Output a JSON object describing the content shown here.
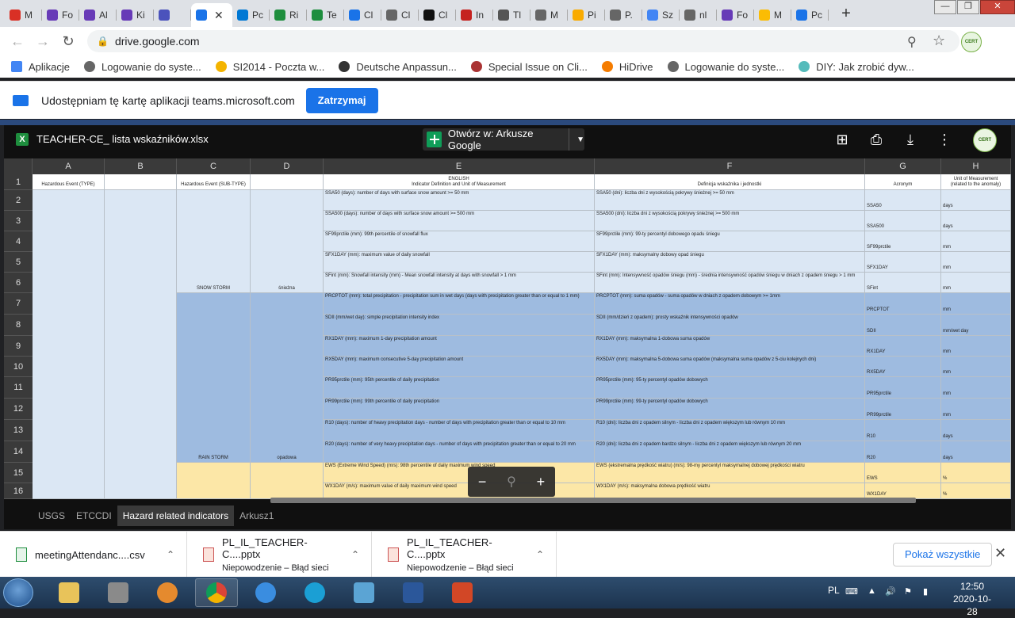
{
  "browser": {
    "tabs": [
      {
        "label": "M",
        "color": "#d93025"
      },
      {
        "label": "Fo",
        "color": "#673ab7"
      },
      {
        "label": "Al",
        "color": "#673ab7"
      },
      {
        "label": "Ki",
        "color": "#673ab7"
      },
      {
        "label": "",
        "color": "#4b53bc"
      },
      {
        "label": "",
        "color": "#1a73e8",
        "active": true
      },
      {
        "label": "Pc",
        "color": "#0078d4"
      },
      {
        "label": "Ri",
        "color": "#1e8e3e"
      },
      {
        "label": "Te",
        "color": "#1e8e3e"
      },
      {
        "label": "Cl",
        "color": "#1a73e8"
      },
      {
        "label": "Cl",
        "color": "#666"
      },
      {
        "label": "Cl",
        "color": "#111"
      },
      {
        "label": "In",
        "color": "#c5221f"
      },
      {
        "label": "Tl",
        "color": "#555"
      },
      {
        "label": "M",
        "color": "#666"
      },
      {
        "label": "Pi",
        "color": "#f9ab00"
      },
      {
        "label": "P.",
        "color": "#666"
      },
      {
        "label": "Sz",
        "color": "#4285f4"
      },
      {
        "label": "nl",
        "color": "#666"
      },
      {
        "label": "Fo",
        "color": "#673ab7"
      },
      {
        "label": "M",
        "color": "#fbbc04"
      },
      {
        "label": "Pc",
        "color": "#1a73e8"
      }
    ],
    "new_tab": "+",
    "window_controls": {
      "min": "—",
      "max": "❐",
      "close": "✕"
    },
    "url": "drive.google.com",
    "profile_label": "CERT"
  },
  "bookmarks": [
    {
      "label": "Aplikacje",
      "color": "#4285f4"
    },
    {
      "label": "Logowanie do syste...",
      "color": "#666"
    },
    {
      "label": "SI2014 - Poczta w...",
      "color": "#f4b400"
    },
    {
      "label": "Deutsche Anpassun...",
      "color": "#333"
    },
    {
      "label": "Special Issue on Cli...",
      "color": "#a33"
    },
    {
      "label": "HiDrive",
      "color": "#f57c00"
    },
    {
      "label": "Logowanie do syste...",
      "color": "#666"
    },
    {
      "label": "DIY: Jak zrobić dyw...",
      "color": "#5bb"
    }
  ],
  "infobar": {
    "text": "Udostępniam tę kartę aplikacji teams.microsoft.com",
    "stop_label": "Zatrzymaj"
  },
  "viewer": {
    "file_name": "TEACHER-CE_ lista wskaźników.xlsx",
    "open_with": "Otwórz w: Arkusze Google",
    "profile_label": "CERT",
    "zoom_minus": "−",
    "zoom_plus": "+"
  },
  "sheet": {
    "columns": [
      "A",
      "B",
      "C",
      "D",
      "E",
      "F",
      "G",
      "H"
    ],
    "header_row": {
      "A": "Hazardous Event (TYPE)",
      "C": "Hazardous Event (SUB-TYPE)",
      "E1": "ENGLISH",
      "E2": "Indicator Definition and Unit of Measurement",
      "F": "Definicja wskaźnika i jednostki",
      "G": "Acronym",
      "H1": "Unit of Measurement",
      "H2": "(related to the anomaly)"
    },
    "row_numbers": [
      "1",
      "2",
      "3",
      "4",
      "5",
      "6",
      "7",
      "8",
      "9",
      "10",
      "11",
      "12",
      "13",
      "14",
      "15",
      "16"
    ],
    "group_labels": {
      "snow_c": "SNOW STORM",
      "snow_d": "śnieżna",
      "rain_c": "RAIN STORM",
      "rain_d": "opadowa"
    },
    "rows": [
      {
        "e": "SSA50 (days): number of days with surface snow amount >= 50 mm",
        "f": "SSA50 (dni): liczba dni z wysokością pokrywy śnieżnej >= 50 mm",
        "g": "SSA50",
        "h": "days"
      },
      {
        "e": "SSA500 (days): number of days with surface snow amount >= 500 mm",
        "f": "SSA500 (dni): liczba dni z wysokością pokrywy śnieżnej >= 500 mm",
        "g": "SSA500",
        "h": "days"
      },
      {
        "e": "SF99prctile (mm): 99th percentile of snowfall flux",
        "f": "SF99prctile (mm): 99-ty percentyl dobowego opadu śniegu",
        "g": "SF99prctile",
        "h": "mm"
      },
      {
        "e": "SFX1DAY (mm): maximum value of daily snowfall",
        "f": "SFX1DAY (mm): maksymalny dobowy opad śniegu",
        "g": "SFX1DAY",
        "h": "mm"
      },
      {
        "e": "SFint (mm): Snowfall intensity (mm) - Mean snowfall intensity at days with snowfall > 1 mm",
        "f": "SFint (mm): Intensywność opadów śniegu (mm) - średnia intensywność opadów śniegu w dniach z opadem śniegu > 1 mm",
        "g": "SFint",
        "h": "mm"
      },
      {
        "e": "PRCPTOT (mm): total precipitation - precipitation sum in wet days (days with precipitation greater than or equal to 1 mm)",
        "f": "PRCPTOT (mm): suma opadów - suma opadów w dniach z opadem dobowym >= 1mm",
        "g": "PRCPTOT",
        "h": "mm"
      },
      {
        "e": "SDII (mm/wet day): simple precipitation intensity index",
        "f": "SDII (mm/dzień z opadem): prosty wskaźnik intensywności opadów",
        "g": "SDII",
        "h": "mm/wet day"
      },
      {
        "e": "RX1DAY (mm): maximum 1-day precipitation amount",
        "f": "RX1DAY (mm): maksymalna 1-dobowa suma opadów",
        "g": "RX1DAY",
        "h": "mm"
      },
      {
        "e": "RX5DAY (mm): maximum consecutive 5-day precipitation amount",
        "f": "RX5DAY (mm): maksymalna 5-dobowa suma opadów (maksymalna suma opadów z 5-ciu kolejnych dni)",
        "g": "RX5DAY",
        "h": "mm"
      },
      {
        "e": "PR95prctile (mm): 95th percentile of daily precipitation",
        "f": "PR95prctile (mm): 95-ty percentyl opadów dobowych",
        "g": "PR95prctile",
        "h": "mm"
      },
      {
        "e": "PR99prctile (mm): 99th percentile of daily precipitation",
        "f": "PR99prctile (mm): 99-ty percentyl opadów dobowych",
        "g": "PR99prctile",
        "h": "mm"
      },
      {
        "e": "R10 (days): number of heavy precipitation days - number of days with precipitation greater than or equal to 10 mm",
        "f": "R10 (dni): liczba dni z opadem silnym - liczba dni z opadem większym lub równym 10 mm",
        "g": "R10",
        "h": "days"
      },
      {
        "e": "R20 (days): number of very heavy precipitation days - number of days with precipitation greater than or equal to 20 mm",
        "f": "R20 (dni): liczba dni z opadem bardzo silnym - liczba dni z opadem większym lub równym 20 mm",
        "g": "R20",
        "h": "days"
      },
      {
        "e": "EWS (Extreme Wind Speed) (m/s): 98th percentile of daily maximum wind speed",
        "f": "EWS (ekstremalna prędkość wiatru) (m/s): 98-my percentyl maksymalnej dobowej prędkości wiatru",
        "g": "EWS",
        "h": "%"
      },
      {
        "e": "WX1DAY (m/s): maximum value of daily maximum wind speed",
        "f": "WX1DAY (m/s): maksymalna dobowa prędkość wiatru",
        "g": "WX1DAY",
        "h": "%"
      }
    ],
    "tabs": [
      "USGS",
      "ETCCDI",
      "Hazard related indicators",
      "Arkusz1"
    ],
    "active_tab": "Hazard related indicators"
  },
  "downloads": {
    "items": [
      {
        "name": "meetingAttendanc....csv",
        "status": ""
      },
      {
        "name": "PL_IL_TEACHER-C....pptx",
        "status": "Niepowodzenie – Błąd sieci"
      },
      {
        "name": "PL_IL_TEACHER-C....pptx",
        "status": "Niepowodzenie – Błąd sieci"
      }
    ],
    "show_all": "Pokaż wszystkie"
  },
  "taskbar": {
    "lang": "PL",
    "time": "12:50",
    "date": "2020-10-28"
  }
}
